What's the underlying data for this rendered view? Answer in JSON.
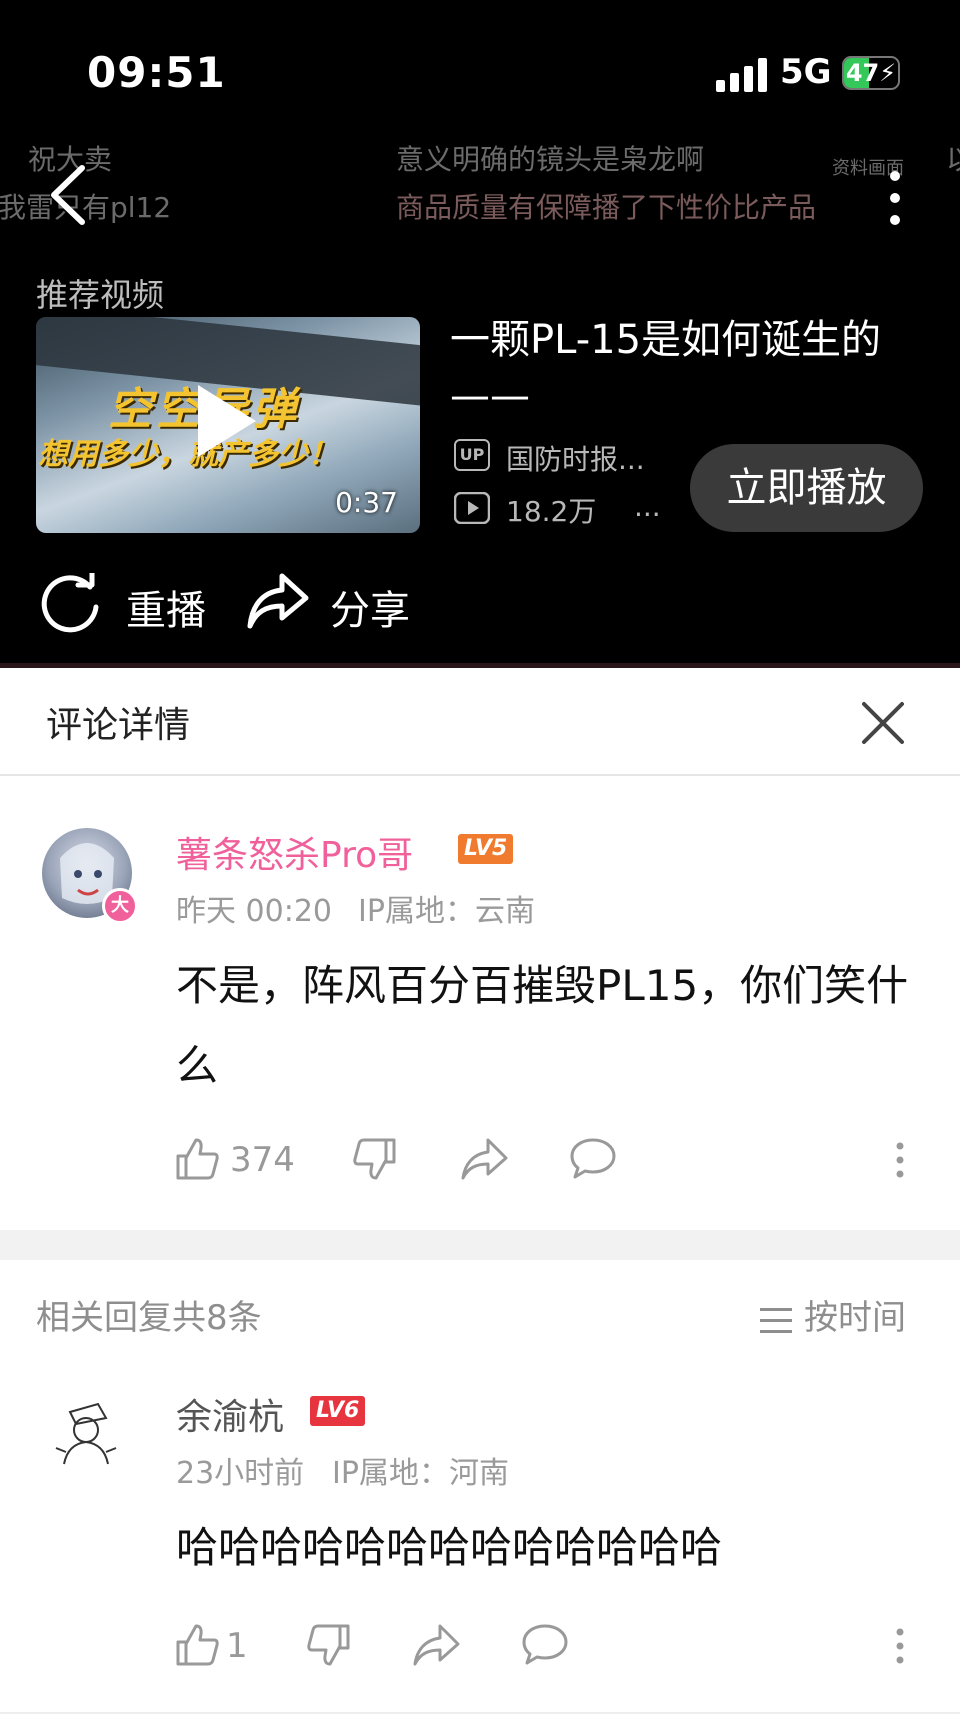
{
  "status_bar": {
    "time": "09:51",
    "network": "5G",
    "battery": "47",
    "battery_level": 0.47
  },
  "danmaku": [
    "祝大卖",
    "我雷只有pl12",
    "意义明确的镜头是枭龙啊",
    "商品质量有保障播了下性价比产品",
    "资料画面",
    "以"
  ],
  "recommend": {
    "section_label": "推荐视频",
    "thumb_line1": "空空导弹",
    "thumb_line2": "想用多少，就产多少！",
    "duration": "0:37",
    "title": "一颗PL-15是如何诞生的——",
    "up_badge": "UP",
    "uploader": "国防时报...",
    "views": "18.2万",
    "views_more": "...",
    "play_now": "立即播放"
  },
  "actions": {
    "replay": "重播",
    "share": "分享"
  },
  "panel": {
    "title": "评论详情"
  },
  "main_comment": {
    "username": "薯条怒杀Pro哥",
    "level": "LV5",
    "badge": "大",
    "time": "昨天 00:20",
    "ip": "IP属地：云南",
    "text": "不是，阵风百分百摧毁PL15，你们笑什么",
    "likes": "374"
  },
  "replies_header": {
    "count_text": "相关回复共8条",
    "sort_label": "按时间"
  },
  "reply": {
    "username": "余渝杭",
    "level": "LV6",
    "time": "23小时前",
    "ip": "IP属地：河南",
    "text": "哈哈哈哈哈哈哈哈哈哈哈哈哈",
    "likes": "1"
  },
  "colors": {
    "pink_name": "#f0609a",
    "lv5": "#f07a2e",
    "lv6": "#e7353f",
    "battery": "#34c759"
  }
}
